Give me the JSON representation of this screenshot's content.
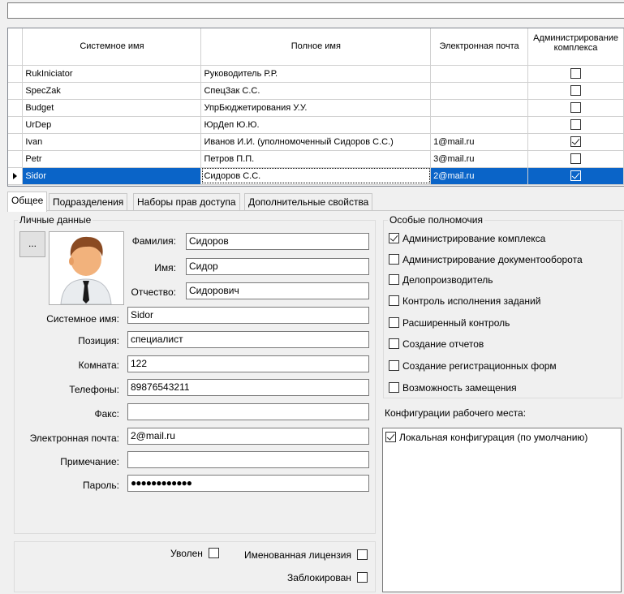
{
  "grid": {
    "headers": [
      "Системное имя",
      "Полное имя",
      "Электронная почта",
      "Администрирование комплекса"
    ],
    "rows": [
      {
        "sys": "RukIniciator",
        "full": "Руководитель Р.Р.",
        "email": "",
        "admin": false
      },
      {
        "sys": "SpecZak",
        "full": "СпецЗак С.С.",
        "email": "",
        "admin": false
      },
      {
        "sys": "Budget",
        "full": "УпрБюджетирования У.У.",
        "email": "",
        "admin": false
      },
      {
        "sys": "UrDep",
        "full": "ЮрДеп Ю.Ю.",
        "email": "",
        "admin": false
      },
      {
        "sys": "Ivan",
        "full": "Иванов И.И. (уполномоченный Сидоров С.С.)",
        "email": "1@mail.ru",
        "admin": true
      },
      {
        "sys": "Petr",
        "full": "Петров П.П.",
        "email": "3@mail.ru",
        "admin": false
      },
      {
        "sys": "Sidor",
        "full": "Сидоров С.С.",
        "email": "2@mail.ru",
        "admin": true,
        "selected": true
      }
    ]
  },
  "tabs": [
    "Общее",
    "Подразделения",
    "Наборы прав доступа",
    "Дополнительные свойства"
  ],
  "personal": {
    "legend": "Личные данные",
    "browse_label": "...",
    "labels": {
      "last_name": "Фамилия:",
      "first_name": "Имя:",
      "patronymic": "Отчество:",
      "system_name": "Системное имя:",
      "position": "Позиция:",
      "room": "Комната:",
      "phones": "Телефоны:",
      "fax": "Факс:",
      "email": "Электронная почта:",
      "note": "Примечание:",
      "password": "Пароль:"
    },
    "values": {
      "last_name": "Сидоров",
      "first_name": "Сидор",
      "patronymic": "Сидорович",
      "system_name": "Sidor",
      "position": "специалист",
      "room": "122",
      "phones": "89876543211",
      "fax": "",
      "email": "2@mail.ru",
      "note": "",
      "password": "●●●●●●●●●●●●"
    }
  },
  "flags": [
    {
      "label": "Уволен",
      "checked": false
    },
    {
      "label": "Именованная лицензия",
      "checked": false
    },
    {
      "label": "Заблокирован",
      "checked": false
    }
  ],
  "special": {
    "legend": "Особые полномочия",
    "items": [
      {
        "label": "Администрирование комплекса",
        "checked": true
      },
      {
        "label": "Администрирование документооборота",
        "checked": false
      },
      {
        "label": "Делопроизводитель",
        "checked": false
      },
      {
        "label": "Контроль исполнения заданий",
        "checked": false
      },
      {
        "label": "Расширенный контроль",
        "checked": false
      },
      {
        "label": "Создание отчетов",
        "checked": false
      },
      {
        "label": "Создание регистрационных форм",
        "checked": false
      },
      {
        "label": "Возможность замещения",
        "checked": false
      }
    ]
  },
  "workplace": {
    "label": "Конфигурации рабочего места:",
    "items": [
      {
        "label": "Локальная конфигурация (по умолчанию)",
        "checked": true
      }
    ]
  }
}
